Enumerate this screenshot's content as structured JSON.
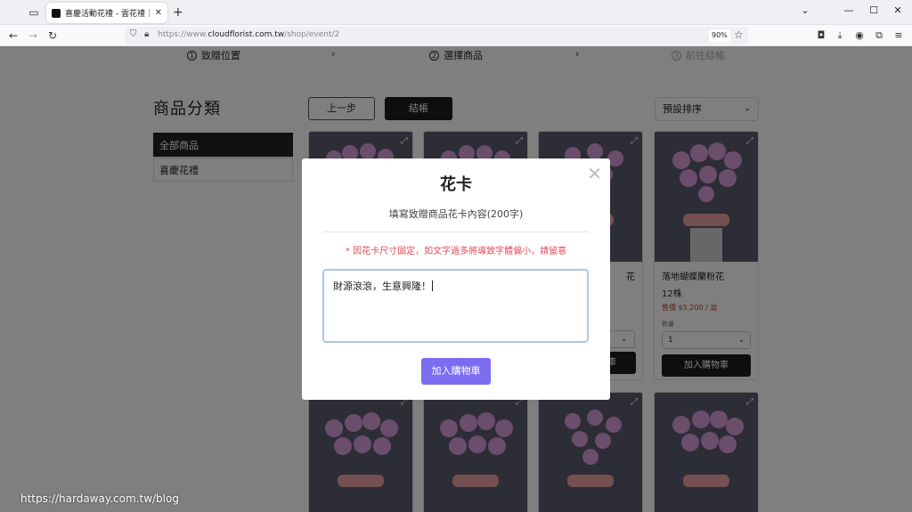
{
  "browser": {
    "tab_title": "喜慶活動花禮 - 雲花禮｜全台花",
    "url_prefix": "https://www.",
    "url_host": "cloudflorist.com.tw",
    "url_path": "/shop/event/2",
    "zoom": "90%"
  },
  "steps": [
    {
      "num": "1",
      "label": "致贈位置"
    },
    {
      "num": "2",
      "label": "選擇商品"
    },
    {
      "num": "3",
      "label": "前往結帳"
    }
  ],
  "sidebar": {
    "title": "商品分類",
    "items": [
      {
        "label": "全部商品"
      },
      {
        "label": "喜慶花禮"
      }
    ]
  },
  "toolbar": {
    "back_label": "上一步",
    "checkout_label": "結帳",
    "sort_value": "預設排序"
  },
  "products": {
    "visible_card": {
      "name": "落地蝴蝶蘭粉花",
      "qty": "12株",
      "price": "售價 $5,200 / 盆",
      "qty_label": "數量",
      "qty_value": "1",
      "add_label": "加入購物車"
    },
    "partial_name_tail": "花",
    "partial_add_tail": "車"
  },
  "modal": {
    "title": "花卡",
    "subtitle": "填寫致贈商品花卡內容(200字)",
    "note": "* 因花卡尺寸固定，如文字過多將導致字體偏小，請留意",
    "textarea_value": "財源滾滾，生意興隆！",
    "add_label": "加入購物車"
  },
  "watermark": "https://hardaway.com.tw/blog",
  "colors": {
    "accent_button": "#7b6cf0",
    "note_red": "#e04a5a",
    "dark_button": "#1c1c1c"
  }
}
